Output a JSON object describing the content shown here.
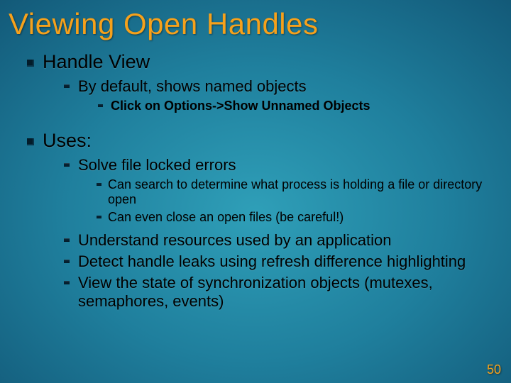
{
  "title": "Viewing Open Handles",
  "page_number": "50",
  "bullets": [
    {
      "text": "Handle View",
      "children": [
        {
          "text": "By default, shows named objects",
          "children": [
            {
              "text": "Click on Options->Show Unnamed Objects"
            }
          ]
        }
      ]
    },
    {
      "text": "Uses:",
      "children": [
        {
          "text": "Solve file locked errors",
          "children": [
            {
              "text": "Can search to determine what process is holding a file or directory open"
            },
            {
              "text": "Can even close an open files (be careful!)"
            }
          ]
        },
        {
          "text": "Understand resources used by an application"
        },
        {
          "text": "Detect handle leaks using refresh difference highlighting"
        },
        {
          "text": "View the state of synchronization objects (mutexes, semaphores, events)"
        }
      ]
    }
  ]
}
